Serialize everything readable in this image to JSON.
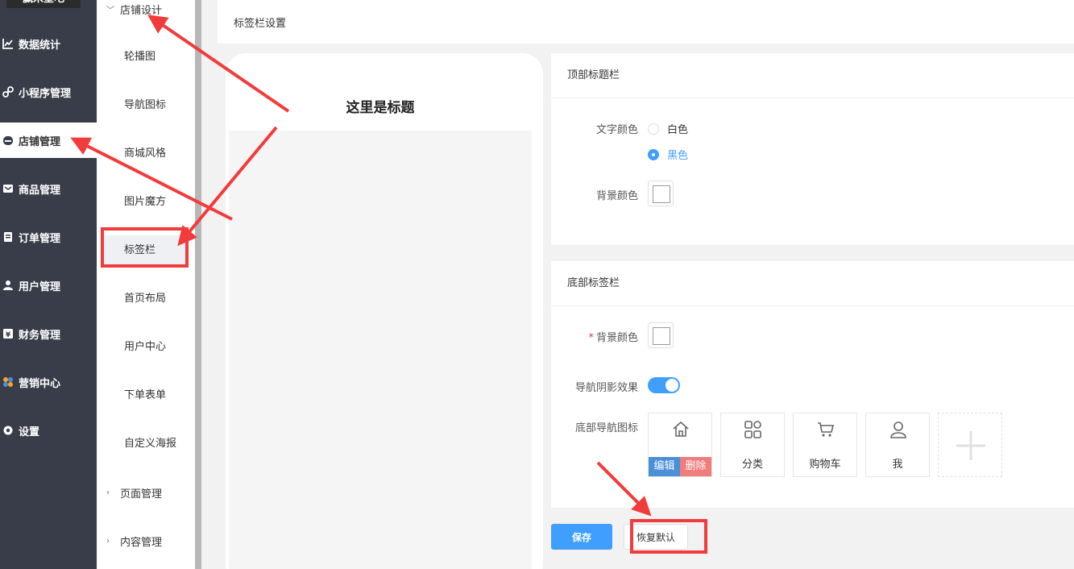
{
  "sidebar": {
    "logo": "赢米星吧",
    "items": [
      {
        "label": "数据统计",
        "icon": "chart-icon"
      },
      {
        "label": "小程序管理",
        "icon": "miniprogram-icon"
      },
      {
        "label": "店铺管理",
        "icon": "store-icon"
      },
      {
        "label": "商品管理",
        "icon": "goods-icon"
      },
      {
        "label": "订单管理",
        "icon": "order-icon"
      },
      {
        "label": "用户管理",
        "icon": "user-icon"
      },
      {
        "label": "财务管理",
        "icon": "finance-icon"
      },
      {
        "label": "营销中心",
        "icon": "marketing-icon"
      },
      {
        "label": "设置",
        "icon": "gear-icon"
      }
    ],
    "active": "店铺管理"
  },
  "submenu": {
    "group1": "店铺设计",
    "items": [
      "轮播图",
      "导航图标",
      "商城风格",
      "图片魔方",
      "标签栏",
      "首页布局",
      "用户中心",
      "下单表单",
      "自定义海报"
    ],
    "selected": "标签栏",
    "group2": "页面管理",
    "group3": "内容管理"
  },
  "page": {
    "title": "标签栏设置",
    "preview_title": "这里是标题"
  },
  "top_bar": {
    "title": "顶部标题栏",
    "text_color_label": "文字颜色",
    "options": [
      "白色",
      "黑色"
    ],
    "selected": "黑色",
    "bg_color_label": "背景颜色",
    "bg_color": "#ffffff"
  },
  "bottom_bar": {
    "title": "底部标签栏",
    "bg_color_label": "背景颜色",
    "bg_color": "#ffffff",
    "shadow_label": "导航阴影效果",
    "shadow_on": true,
    "nav_icons_label": "底部导航图标",
    "edit_label": "编辑",
    "delete_label": "删除",
    "nav_items": [
      {
        "label": "",
        "icon": "home-icon"
      },
      {
        "label": "分类",
        "icon": "category-icon"
      },
      {
        "label": "购物车",
        "icon": "cart-icon"
      },
      {
        "label": "我",
        "icon": "person-icon"
      }
    ]
  },
  "actions": {
    "save": "保存",
    "reset": "恢复默认"
  },
  "colors": {
    "sidebar_bg": "#393d49",
    "accent": "#409eff",
    "annotation": "#f23b3b"
  }
}
